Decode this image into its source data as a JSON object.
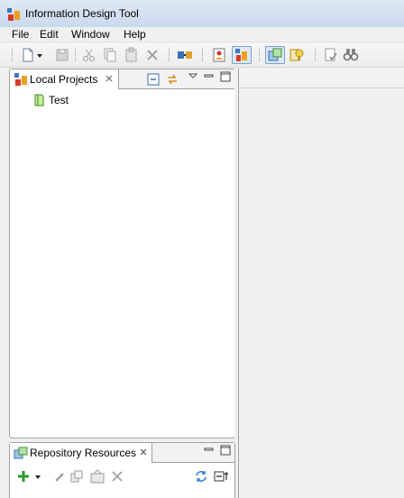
{
  "window": {
    "title": "Information Design Tool"
  },
  "menu": {
    "items": [
      "File",
      "Edit",
      "Window",
      "Help"
    ]
  },
  "toolbar": {
    "buttons": [
      "new-icon",
      "dropdown-arrow-icon",
      "save-icon",
      "cut-icon",
      "copy-icon",
      "paste-icon",
      "delete-icon",
      "connection-icon",
      "security-editor-icon",
      "idt-perspective-icon",
      "layout-icon",
      "query-panel-icon",
      "check-integrity-icon",
      "find-icon"
    ]
  },
  "local_projects": {
    "tab_label": "Local Projects",
    "items": [
      {
        "label": "Test",
        "icon": "project-icon"
      }
    ]
  },
  "repository_resources": {
    "tab_label": "Repository Resources"
  },
  "colors": {
    "title_gradient_top": "#dfe9f5",
    "title_gradient_bottom": "#c9d9ed",
    "view_border": "#a0a0a0",
    "background": "#f0f0f0"
  }
}
